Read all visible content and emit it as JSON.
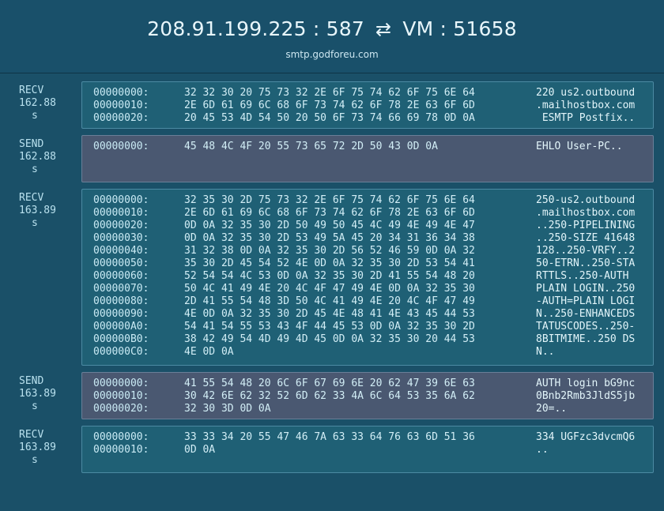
{
  "header": {
    "left": "208.91.199.225 : 587",
    "arrows": "⇄",
    "right": "VM : 51658",
    "host": "smtp.godforeu.com"
  },
  "packets": [
    {
      "dir": "RECV",
      "time": "162.88",
      "unit": "s",
      "type": "recv",
      "lines": [
        {
          "off": "00000000:",
          "hex": "32 32 30 20 75 73 32 2E 6F 75 74 62 6F 75 6E 64",
          "asc": "220 us2.outbound"
        },
        {
          "off": "00000010:",
          "hex": "2E 6D 61 69 6C 68 6F 73 74 62 6F 78 2E 63 6F 6D",
          "asc": ".mailhostbox.com"
        },
        {
          "off": "00000020:",
          "hex": "20 45 53 4D 54 50 20 50 6F 73 74 66 69 78 0D 0A",
          "asc": " ESMTP Postfix.."
        }
      ]
    },
    {
      "dir": "SEND",
      "time": "162.88",
      "unit": "s",
      "type": "send",
      "lines": [
        {
          "off": "00000000:",
          "hex": "45 48 4C 4F 20 55 73 65 72 2D 50 43 0D 0A",
          "asc": "EHLO User-PC.."
        }
      ]
    },
    {
      "dir": "RECV",
      "time": "163.89",
      "unit": "s",
      "type": "recv",
      "lines": [
        {
          "off": "00000000:",
          "hex": "32 35 30 2D 75 73 32 2E 6F 75 74 62 6F 75 6E 64",
          "asc": "250-us2.outbound"
        },
        {
          "off": "00000010:",
          "hex": "2E 6D 61 69 6C 68 6F 73 74 62 6F 78 2E 63 6F 6D",
          "asc": ".mailhostbox.com"
        },
        {
          "off": "00000020:",
          "hex": "0D 0A 32 35 30 2D 50 49 50 45 4C 49 4E 49 4E 47",
          "asc": "..250-PIPELINING"
        },
        {
          "off": "00000030:",
          "hex": "0D 0A 32 35 30 2D 53 49 5A 45 20 34 31 36 34 38",
          "asc": "..250-SIZE 41648"
        },
        {
          "off": "00000040:",
          "hex": "31 32 38 0D 0A 32 35 30 2D 56 52 46 59 0D 0A 32",
          "asc": "128..250-VRFY..2"
        },
        {
          "off": "00000050:",
          "hex": "35 30 2D 45 54 52 4E 0D 0A 32 35 30 2D 53 54 41",
          "asc": "50-ETRN..250-STA"
        },
        {
          "off": "00000060:",
          "hex": "52 54 54 4C 53 0D 0A 32 35 30 2D 41 55 54 48 20",
          "asc": "RTTLS..250-AUTH "
        },
        {
          "off": "00000070:",
          "hex": "50 4C 41 49 4E 20 4C 4F 47 49 4E 0D 0A 32 35 30",
          "asc": "PLAIN LOGIN..250"
        },
        {
          "off": "00000080:",
          "hex": "2D 41 55 54 48 3D 50 4C 41 49 4E 20 4C 4F 47 49",
          "asc": "-AUTH=PLAIN LOGI"
        },
        {
          "off": "00000090:",
          "hex": "4E 0D 0A 32 35 30 2D 45 4E 48 41 4E 43 45 44 53",
          "asc": "N..250-ENHANCEDS"
        },
        {
          "off": "000000A0:",
          "hex": "54 41 54 55 53 43 4F 44 45 53 0D 0A 32 35 30 2D",
          "asc": "TATUSCODES..250-"
        },
        {
          "off": "000000B0:",
          "hex": "38 42 49 54 4D 49 4D 45 0D 0A 32 35 30 20 44 53",
          "asc": "8BITMIME..250 DS"
        },
        {
          "off": "000000C0:",
          "hex": "4E 0D 0A",
          "asc": "N.."
        }
      ]
    },
    {
      "dir": "SEND",
      "time": "163.89",
      "unit": "s",
      "type": "send",
      "lines": [
        {
          "off": "00000000:",
          "hex": "41 55 54 48 20 6C 6F 67 69 6E 20 62 47 39 6E 63",
          "asc": "AUTH login bG9nc"
        },
        {
          "off": "00000010:",
          "hex": "30 42 6E 62 32 52 6D 62 33 4A 6C 64 53 35 6A 62",
          "asc": "0Bnb2Rmb3JldS5jb"
        },
        {
          "off": "00000020:",
          "hex": "32 30 3D 0D 0A",
          "asc": "20=.."
        }
      ]
    },
    {
      "dir": "RECV",
      "time": "163.89",
      "unit": "s",
      "type": "recv",
      "lines": [
        {
          "off": "00000000:",
          "hex": "33 33 34 20 55 47 46 7A 63 33 64 76 63 6D 51 36",
          "asc": "334 UGFzc3dvcmQ6"
        },
        {
          "off": "00000010:",
          "hex": "0D 0A",
          "asc": ".."
        }
      ]
    }
  ]
}
